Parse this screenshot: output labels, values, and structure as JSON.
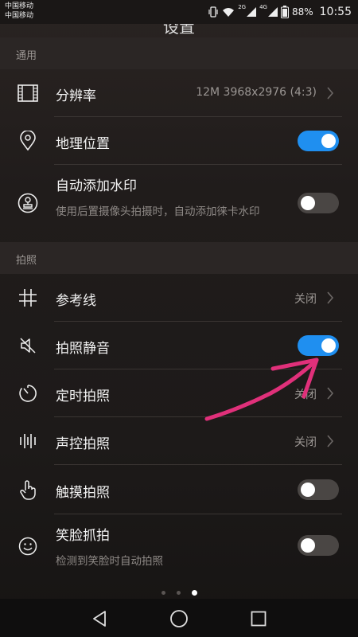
{
  "status_bar": {
    "carrier1": "中国移动",
    "carrier2": "中国移动",
    "net_sim1": "2G",
    "net_sim2": "4G",
    "battery": "88%",
    "time": "10:55"
  },
  "title": "设置",
  "sections": {
    "general": "通用",
    "capture": "拍照"
  },
  "items": {
    "resolution": {
      "label": "分辨率",
      "value": "12M 3968x2976 (4:3)",
      "icon": "film-frame-icon"
    },
    "location": {
      "label": "地理位置",
      "checked": true,
      "icon": "location-pin-icon"
    },
    "watermark": {
      "label": "自动添加水印",
      "sub": "使用后置摄像头拍摄时，自动添加徕卡水印",
      "checked": false,
      "icon": "stamp-icon"
    },
    "gridlines": {
      "label": "参考线",
      "value": "关闭",
      "icon": "grid-icon"
    },
    "mute": {
      "label": "拍照静音",
      "checked": true,
      "icon": "speaker-mute-icon"
    },
    "timer": {
      "label": "定时拍照",
      "value": "关闭",
      "icon": "timer-icon"
    },
    "voice": {
      "label": "声控拍照",
      "value": "关闭",
      "icon": "sound-bars-icon"
    },
    "touch": {
      "label": "触摸拍照",
      "checked": false,
      "icon": "touch-hand-icon"
    },
    "smile": {
      "label": "笑脸抓拍",
      "sub": "检测到笑脸时自动拍照",
      "checked": false,
      "icon": "smile-icon"
    }
  },
  "page_indicator": {
    "count": 3,
    "active": 3
  },
  "colors": {
    "toggle_on": "#1f8ff0",
    "toggle_off": "#4a4644",
    "annotation_arrow": "#e0307a"
  }
}
